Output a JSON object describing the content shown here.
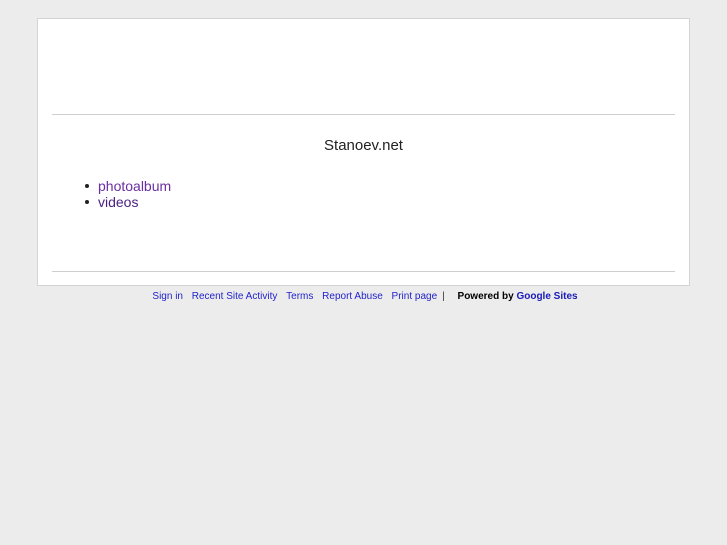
{
  "site": {
    "title": "Stanoev.net"
  },
  "nav": {
    "items": [
      {
        "label": "photoalbum"
      },
      {
        "label": "videos"
      }
    ]
  },
  "footer": {
    "sign_in": "Sign in",
    "recent_activity": "Recent Site Activity",
    "terms": "Terms",
    "report_abuse": "Report Abuse",
    "print_page": "Print page",
    "separator": "|",
    "powered_by": "Powered by",
    "google_sites": "Google Sites"
  },
  "colors": {
    "background": "#ececec",
    "link": "#6a2fa0",
    "footer_link": "#2222cc"
  }
}
